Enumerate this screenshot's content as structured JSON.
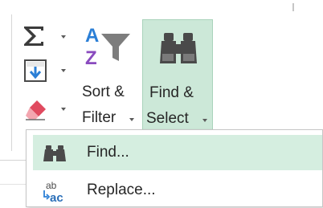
{
  "ribbon": {
    "sort_filter": {
      "label_line1": "Sort &",
      "label_line2": "Filter"
    },
    "find_select": {
      "label_line1": "Find &",
      "label_line2": "Select"
    },
    "small_buttons": [
      {
        "icon": "autosum-icon"
      },
      {
        "icon": "fill-down-icon"
      },
      {
        "icon": "eraser-icon"
      }
    ]
  },
  "menu": {
    "items": [
      {
        "label": "Find...",
        "icon": "binoculars-icon",
        "state": "hover"
      },
      {
        "label": "Replace...",
        "icon": "replace-icon"
      }
    ]
  },
  "colors": {
    "hover_fill": "#cce8d8",
    "accent_blue": "#2b7fd6",
    "sort_purple": "#8a4bbf",
    "eraser_red": "#e04a5f"
  }
}
